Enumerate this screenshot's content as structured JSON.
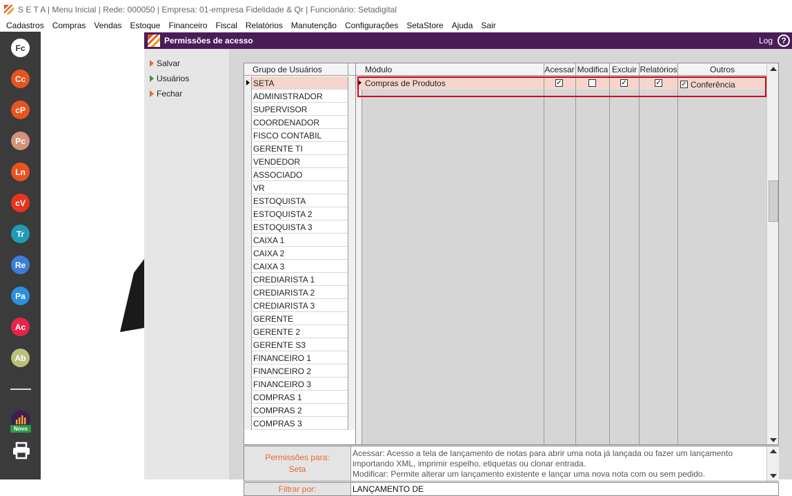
{
  "titlebar": {
    "text": "S E T A | Menu Inicial | Rede: 000050 | Empresa: 01-empresa Fidelidade & Qr | Funcionário: Setadigital"
  },
  "menu": [
    "Cadastros",
    "Compras",
    "Vendas",
    "Estoque",
    "Financeiro",
    "Fiscal",
    "Relatórios",
    "Manutenção",
    "Configurações",
    "SetaStore",
    "Ajuda",
    "Sair"
  ],
  "sidebar": {
    "buttons": [
      {
        "label": "Fc",
        "color": "#ffffff",
        "text_color": "#333333"
      },
      {
        "label": "Cc",
        "color": "#e8541e"
      },
      {
        "label": "cP",
        "color": "#e8541e"
      },
      {
        "label": "Pc",
        "color": "#d4927a"
      },
      {
        "label": "Ln",
        "color": "#e8541e"
      },
      {
        "label": "cV",
        "color": "#e8341e"
      },
      {
        "label": "Tr",
        "color": "#1f9bb8"
      },
      {
        "label": "Re",
        "color": "#3d7dd6"
      },
      {
        "label": "Pa",
        "color": "#2c8fe0"
      },
      {
        "label": "Ac",
        "color": "#e8244a"
      },
      {
        "label": "Ab",
        "color": "#b8c07a"
      }
    ],
    "new_badge": "Novo",
    "new_icon": "bar-chart-icon",
    "print_icon": "printer-icon"
  },
  "window": {
    "title": "Permissões de acesso",
    "log_label": "Log",
    "help_label": "?"
  },
  "actions": [
    {
      "label": "Salvar",
      "icon": "orange-triangle"
    },
    {
      "label": "Usuários",
      "icon": "green-triangle"
    },
    {
      "label": "Fechar",
      "icon": "orange-triangle"
    }
  ],
  "groups": {
    "header": "Grupo de Usuários",
    "rows": [
      "SETA",
      "ADMINISTRADOR",
      "SUPERVISOR",
      "COORDENADOR",
      "FISCO CONTABIL",
      "GERENTE TI",
      "VENDEDOR",
      "ASSOCIADO",
      "VR",
      "ESTOQUISTA",
      "ESTOQUISTA 2",
      "ESTOQUISTA 3",
      "CAIXA 1",
      "CAIXA 2",
      "CAIXA 3",
      "CREDIARISTA 1",
      "CREDIARISTA 2",
      "CREDIARISTA 3",
      "GERENTE",
      "GERENTE 2",
      "GERENTE S3",
      "FINANCEIRO 1",
      "FINANCEIRO 2",
      "FINANCEIRO 3",
      "COMPRAS 1",
      "COMPRAS 2",
      "COMPRAS 3"
    ],
    "selected": "SETA"
  },
  "modules": {
    "headers": {
      "modulo": "Módulo",
      "acessar": "Acessar",
      "modifica": "Modifica",
      "excluir": "Excluir",
      "relatorios": "Relatórios",
      "outros": "Outros"
    },
    "row": {
      "name": "Compras de Produtos",
      "acessar": true,
      "modifica": false,
      "excluir": true,
      "relatorios": true,
      "outros_checked": true,
      "outros_label": "Conferência"
    }
  },
  "permissions": {
    "label": "Permissões para:",
    "group": "Seta",
    "desc_line1": "Acessar: Acesso a tela de lançamento de notas para abrir uma nota já lançada ou fazer um lançamento",
    "desc_line2": "importando XML, imprimir espelho, etiquetas ou clonar entrada.",
    "desc_line3": "Modificar: Permite alterar um lançamento existente e lançar uma nova nota com ou sem pedido."
  },
  "filter": {
    "label": "Filtrar por:",
    "value": "LANÇAMENTO DE"
  }
}
